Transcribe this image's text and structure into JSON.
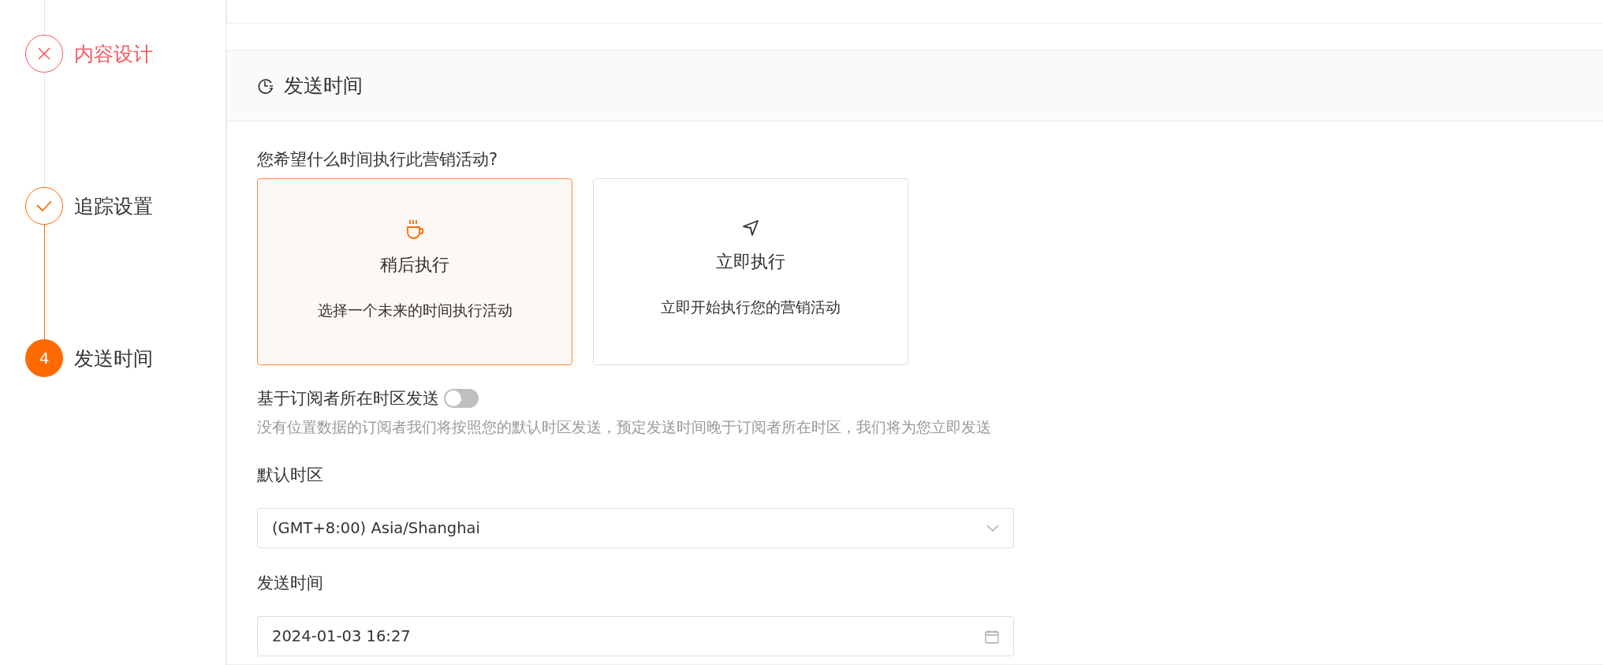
{
  "steps": [
    {
      "label": "内容设计",
      "kind": "error"
    },
    {
      "label": "追踪设置",
      "kind": "finish"
    },
    {
      "label": "发送时间",
      "kind": "process",
      "number": "4"
    }
  ],
  "section": {
    "title": "发送时间",
    "question": "您希望什么时间执行此营销活动?",
    "options": [
      {
        "kind": "later",
        "title": "稍后执行",
        "description": "选择一个未来的时间执行活动",
        "selected": true
      },
      {
        "kind": "now",
        "title": "立即执行",
        "description": "立即开始执行您的营销活动",
        "selected": false
      }
    ],
    "timezone_toggle": {
      "label": "基于订阅者所在时区发送",
      "on": false,
      "hint": "没有位置数据的订阅者我们将按照您的默认时区发送，预定发送时间晚于订阅者所在时区，我们将为您立即发送"
    },
    "default_timezone": {
      "label": "默认时区",
      "value": "(GMT+8:00) Asia/Shanghai"
    },
    "send_time": {
      "label": "发送时间",
      "value": "2024-01-03 16:27"
    }
  }
}
